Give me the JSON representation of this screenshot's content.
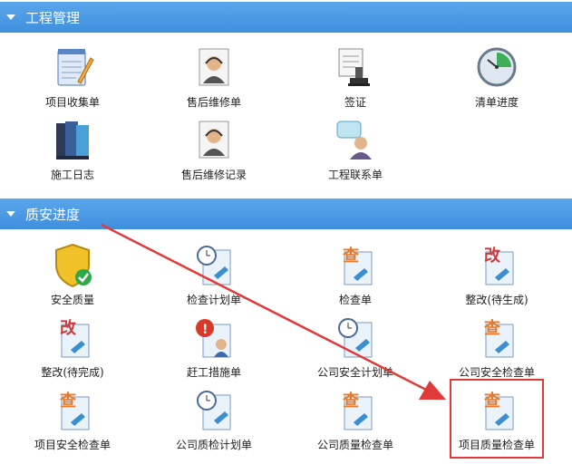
{
  "sections": [
    {
      "title": "工程管理",
      "items": [
        {
          "label": "项目收集单",
          "icon": "notepad-pencil-icon"
        },
        {
          "label": "售后维修单",
          "icon": "support-agent-doc-icon"
        },
        {
          "label": "签证",
          "icon": "document-stamp-icon"
        },
        {
          "label": "清单进度",
          "icon": "clock-progress-icon"
        },
        {
          "label": "施工日志",
          "icon": "books-icon"
        },
        {
          "label": "售后维修记录",
          "icon": "support-agent-doc-icon"
        },
        {
          "label": "工程联系单",
          "icon": "contact-chat-icon"
        }
      ]
    },
    {
      "title": "质安进度",
      "items": [
        {
          "label": "安全质量",
          "icon": "shield-check-icon"
        },
        {
          "label": "检查计划单",
          "icon": "clock-wrench-doc-icon"
        },
        {
          "label": "检查单",
          "icon": "inspect-stamp-doc-icon",
          "badge": "查"
        },
        {
          "label": "整改(待生成)",
          "icon": "rectify-stamp-doc-icon",
          "badge": "改"
        },
        {
          "label": "整改(待完成)",
          "icon": "rectify-stamp-doc-icon",
          "badge": "改"
        },
        {
          "label": "赶工措施单",
          "icon": "alert-worker-doc-icon"
        },
        {
          "label": "公司安全计划单",
          "icon": "clock-wrench-doc-icon"
        },
        {
          "label": "公司安全检查单",
          "icon": "inspect-stamp-doc-icon",
          "badge": "查"
        },
        {
          "label": "项目安全检查单",
          "icon": "inspect-stamp-doc-icon",
          "badge": "查"
        },
        {
          "label": "公司质检计划单",
          "icon": "clock-wrench-doc-icon"
        },
        {
          "label": "公司质量检查单",
          "icon": "inspect-stamp-doc-icon",
          "badge": "查"
        },
        {
          "label": "项目质量检查单",
          "icon": "inspect-stamp-doc-icon",
          "badge": "查"
        }
      ]
    }
  ],
  "colors": {
    "header": "#4a9be6",
    "annotation": "#e03a3a",
    "badge": "#e8792a"
  }
}
